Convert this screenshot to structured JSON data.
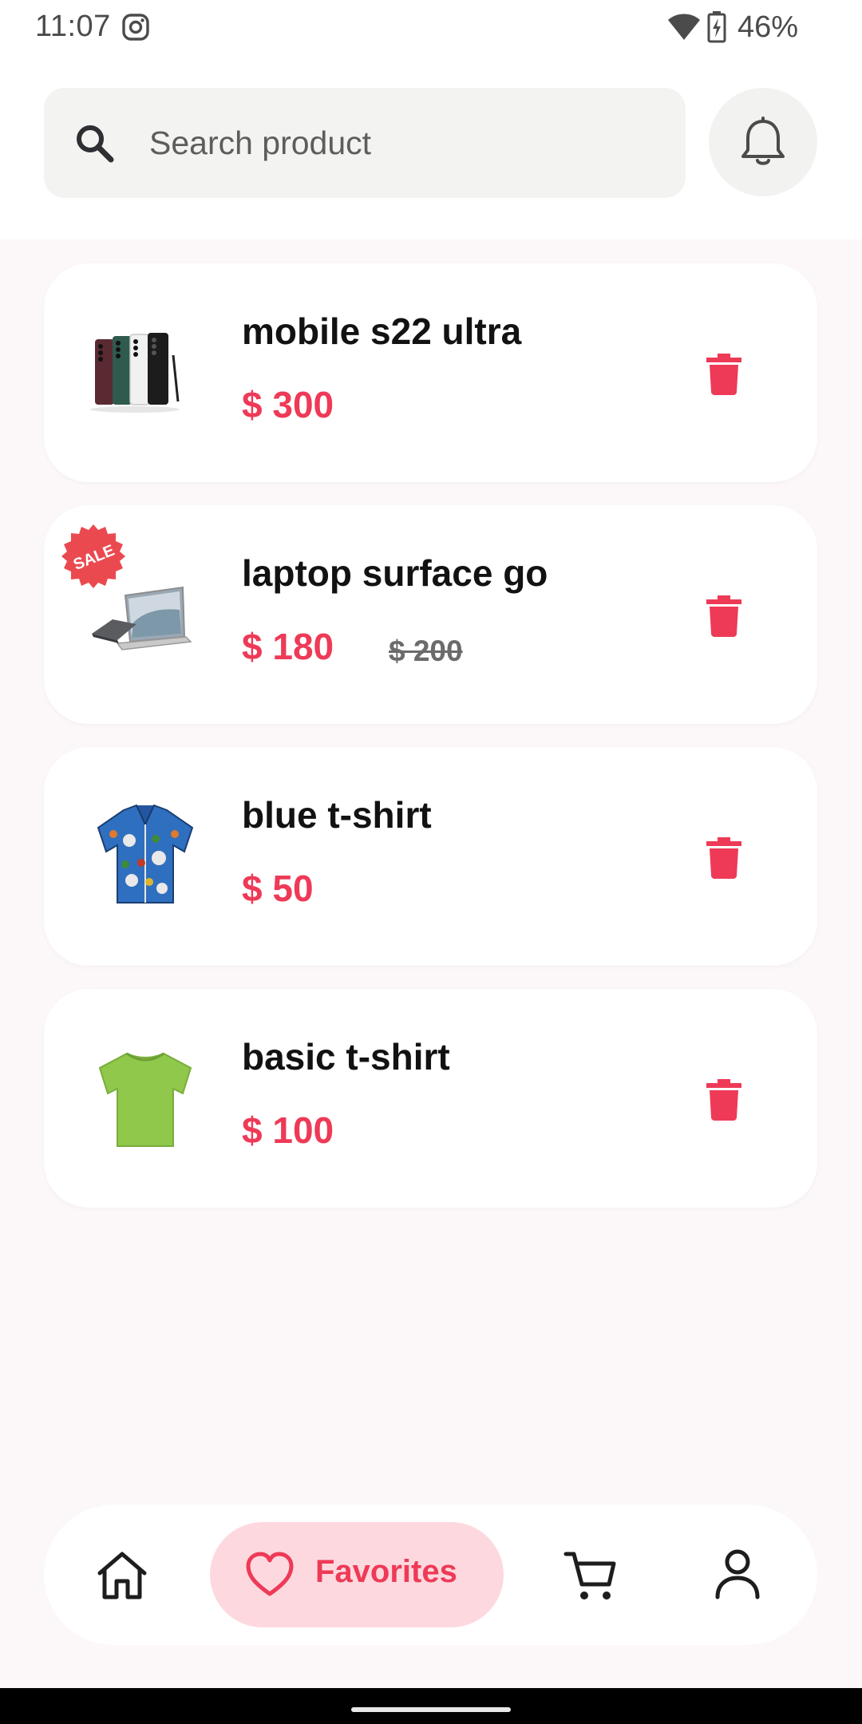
{
  "status_bar": {
    "time": "11:07",
    "battery": "46%",
    "icons": [
      "instagram-icon",
      "wifi-icon",
      "battery-charging-icon"
    ]
  },
  "search": {
    "placeholder": "Search product",
    "value": ""
  },
  "header": {
    "notification_icon": "bell-icon"
  },
  "favorites": [
    {
      "title": "mobile s22 ultra",
      "price": "$ 300",
      "old_price": "",
      "sale": false,
      "image": "phones-image"
    },
    {
      "title": "laptop surface go",
      "price": "$ 180",
      "old_price": "$ 200",
      "sale": true,
      "sale_label": "SALE",
      "image": "laptop-image"
    },
    {
      "title": "blue t-shirt",
      "price": "$ 50",
      "old_price": "",
      "sale": false,
      "image": "hawaiian-shirt-image"
    },
    {
      "title": "basic t-shirt",
      "price": "$ 100",
      "old_price": "",
      "sale": false,
      "image": "green-tshirt-image"
    }
  ],
  "bottom_nav": {
    "items": [
      {
        "icon": "home-icon",
        "label": ""
      },
      {
        "icon": "heart-icon",
        "label": "Favorites",
        "active": true
      },
      {
        "icon": "cart-icon",
        "label": ""
      },
      {
        "icon": "profile-icon",
        "label": ""
      }
    ]
  },
  "colors": {
    "accent": "#ee3a57",
    "accent_soft": "#fdd9df",
    "background": "#fcf7f9",
    "card": "#ffffff",
    "search_bg": "#f3f4f2"
  }
}
